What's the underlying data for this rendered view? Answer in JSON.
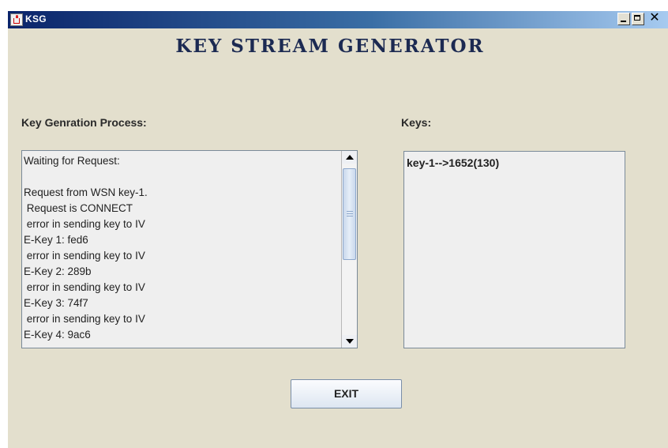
{
  "window": {
    "title": "KSG"
  },
  "header": {
    "heading": "KEY STREAM GENERATOR"
  },
  "process": {
    "label": "Key Genration Process:",
    "lines": [
      "Waiting for Request:",
      "",
      "Request from WSN key-1.",
      " Request is CONNECT",
      " error in sending key to IV",
      "E-Key 1: fed6",
      " error in sending key to IV",
      "E-Key 2: 289b",
      " error in sending key to IV",
      "E-Key 3: 74f7",
      " error in sending key to IV",
      "E-Key 4: 9ac6"
    ]
  },
  "keys": {
    "label": "Keys:",
    "lines": [
      "key-1-->1652(130)"
    ]
  },
  "actions": {
    "exit_label": "EXIT"
  },
  "colors": {
    "window_bg": "#e3dfcd",
    "title_bar_start": "#0a246a",
    "title_bar_end": "#a6caf0",
    "heading_text": "#1c2a52"
  },
  "icons": {
    "app": "java-cup-icon",
    "minimize": "minimize-icon",
    "maximize": "maximize-icon",
    "close": "close-icon"
  }
}
